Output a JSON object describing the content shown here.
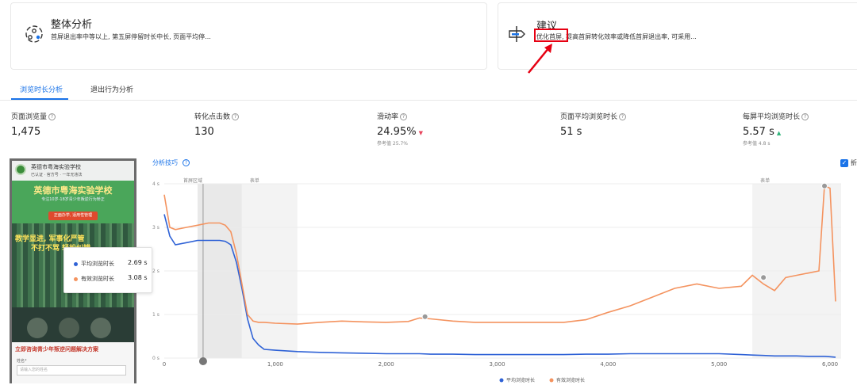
{
  "cards": {
    "overall": {
      "title": "整体分析",
      "desc": "首屏退出率中等以上, 第五屏停留时长中长, 页面平均停...",
      "icon": "analysis-icon"
    },
    "advice": {
      "title": "建议",
      "desc": "优化首屏, 提高首屏转化效率或降低首屏退出率, 可采用...",
      "icon": "signpost-icon"
    }
  },
  "tabs": [
    {
      "label": "浏览时长分析",
      "active": true
    },
    {
      "label": "退出行为分析",
      "active": false
    }
  ],
  "metrics": [
    {
      "label": "页面浏览量",
      "value": "1,475",
      "ref": ""
    },
    {
      "label": "转化点击数",
      "value": "130",
      "ref": ""
    },
    {
      "label": "滑动率",
      "value": "24.95%",
      "ref": "参考值 25.7%",
      "trend": "down"
    },
    {
      "label": "页面平均浏览时长",
      "value": "51 s",
      "ref": ""
    },
    {
      "label": "每屏平均浏览时长",
      "value": "5.57 s",
      "ref": "参考值 4.8 s",
      "trend": "up"
    }
  ],
  "analysis_tip": "分析技巧",
  "checkbox": {
    "label": "折",
    "checked": true
  },
  "phone": {
    "school_name": "英德市粤海实验学校",
    "tags": "已认证 · 官方号 · 一年无违法",
    "banner": "英德市粤海实验学校",
    "sub": "专注10岁-18岁青少年叛逆行为矫正",
    "pill": "正面办学, 适用性管理",
    "slogan": "教学显进, 军事化严管",
    "slogan2": "不打不骂 轻松纠错",
    "cta": "立即咨询青少年叛逆问题解决方案",
    "form_label": "姓名*",
    "form_placeholder": "请输入您的姓名"
  },
  "tooltip": {
    "rows": [
      {
        "label": "平均浏览时长",
        "value": "2.69 s",
        "color": "#2f62d6"
      },
      {
        "label": "有效浏览时长",
        "value": "3.08 s",
        "color": "#f4935f"
      }
    ]
  },
  "colors": {
    "accent": "#1a73e8",
    "avg_line": "#2f62d6",
    "effective_line": "#f4935f",
    "highlight_box": "#e60012"
  },
  "chart_data": {
    "type": "line",
    "x": [
      0,
      50,
      100,
      200,
      300,
      400,
      500,
      550,
      600,
      650,
      700,
      750,
      800,
      850,
      900,
      1000,
      1200,
      1400,
      1600,
      1800,
      2000,
      2200,
      2300,
      2400,
      2600,
      2800,
      3000,
      3200,
      3400,
      3600,
      3800,
      4000,
      4200,
      4400,
      4600,
      4800,
      5000,
      5200,
      5300,
      5400,
      5500,
      5600,
      5700,
      5800,
      5900,
      5950,
      6000,
      6050
    ],
    "series": [
      {
        "name": "平均浏览时长",
        "values": [
          3.3,
          2.8,
          2.6,
          2.65,
          2.7,
          2.7,
          2.7,
          2.68,
          2.6,
          2.2,
          1.6,
          0.9,
          0.45,
          0.3,
          0.2,
          0.18,
          0.15,
          0.13,
          0.12,
          0.11,
          0.1,
          0.1,
          0.1,
          0.09,
          0.09,
          0.08,
          0.08,
          0.08,
          0.08,
          0.08,
          0.09,
          0.09,
          0.1,
          0.1,
          0.1,
          0.1,
          0.1,
          0.08,
          0.07,
          0.06,
          0.05,
          0.05,
          0.05,
          0.04,
          0.04,
          0.04,
          0.03,
          0.02
        ]
      },
      {
        "name": "有效浏览时长",
        "values": [
          3.75,
          3.0,
          2.95,
          3.0,
          3.05,
          3.1,
          3.1,
          3.05,
          2.9,
          2.4,
          1.7,
          1.0,
          0.85,
          0.82,
          0.82,
          0.8,
          0.78,
          0.82,
          0.85,
          0.83,
          0.82,
          0.84,
          0.92,
          0.9,
          0.85,
          0.82,
          0.82,
          0.82,
          0.82,
          0.82,
          0.88,
          1.05,
          1.2,
          1.4,
          1.6,
          1.7,
          1.6,
          1.65,
          1.9,
          1.7,
          1.55,
          1.85,
          1.9,
          1.95,
          2.0,
          3.95,
          3.9,
          1.3
        ]
      }
    ],
    "ylim": [
      0,
      4
    ],
    "xlim": [
      0,
      6100
    ],
    "yticks": [
      {
        "v": 0,
        "label": "0 s"
      },
      {
        "v": 1,
        "label": "1 s"
      },
      {
        "v": 2,
        "label": "2 s"
      },
      {
        "v": 3,
        "label": "3 s"
      },
      {
        "v": 4,
        "label": "4 s"
      }
    ],
    "xticks": [
      {
        "v": 0,
        "label": "0"
      },
      {
        "v": 1000,
        "label": "1,000"
      },
      {
        "v": 2000,
        "label": "2,000"
      },
      {
        "v": 3000,
        "label": "3,000"
      },
      {
        "v": 4000,
        "label": "4,000"
      },
      {
        "v": 5000,
        "label": "5,000"
      },
      {
        "v": 6000,
        "label": "6,000"
      }
    ],
    "regions": [
      {
        "label": "首屏区域",
        "from": 300,
        "to": 700
      },
      {
        "label": "表单",
        "from": 700,
        "to": 1200
      },
      {
        "label": "表单",
        "from": 5300,
        "to": 6100
      }
    ],
    "cursor_x": 350,
    "markers": [
      {
        "x": 2350,
        "y": 0.95
      },
      {
        "x": 5400,
        "y": 1.85
      },
      {
        "x": 5950,
        "y": 3.95
      }
    ],
    "legend_position": "bottom",
    "grid": true
  }
}
